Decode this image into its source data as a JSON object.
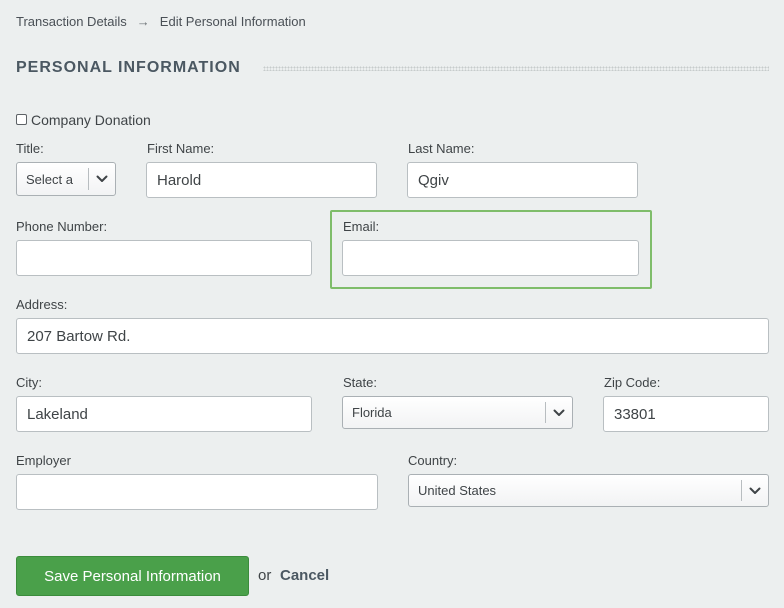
{
  "breadcrumb": {
    "parent": "Transaction Details",
    "separator": "→",
    "current": "Edit Personal Information"
  },
  "section": {
    "title": "PERSONAL INFORMATION"
  },
  "company_donation": {
    "label": "Company Donation",
    "checked": false
  },
  "fields": {
    "title": {
      "label": "Title:",
      "value": "Select a"
    },
    "first_name": {
      "label": "First Name:",
      "value": "Harold"
    },
    "last_name": {
      "label": "Last Name:",
      "value": "Qgiv"
    },
    "phone": {
      "label": "Phone Number:",
      "value": ""
    },
    "email": {
      "label": "Email:",
      "value": ""
    },
    "address": {
      "label": "Address:",
      "value": "207 Bartow Rd."
    },
    "city": {
      "label": "City:",
      "value": "Lakeland"
    },
    "state": {
      "label": "State:",
      "value": "Florida"
    },
    "zip": {
      "label": "Zip Code:",
      "value": "33801"
    },
    "employer": {
      "label": "Employer",
      "value": ""
    },
    "country": {
      "label": "Country:",
      "value": "United States"
    }
  },
  "actions": {
    "save_label": "Save Personal Information",
    "or_text": "or",
    "cancel_label": "Cancel"
  },
  "icons": {
    "dropdown": "chevron-down-icon",
    "breadcrumb_separator": "arrow-right-icon"
  },
  "colors": {
    "background": "#ecefef",
    "primary_button": "#4aa04a",
    "highlight_border": "#7fbd6a",
    "heading": "#4b5862"
  }
}
